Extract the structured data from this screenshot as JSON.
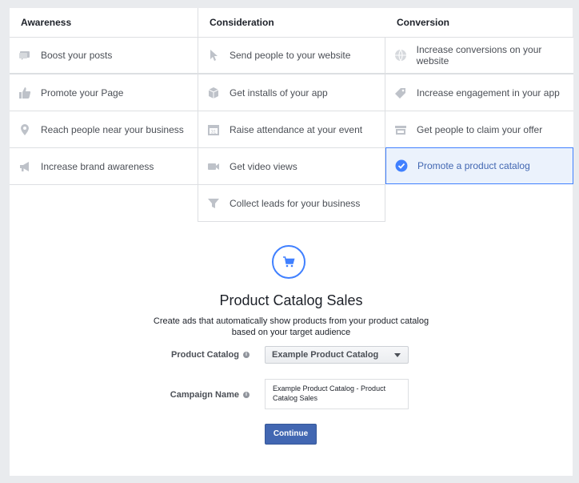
{
  "columns": [
    {
      "header": "Awareness",
      "items": [
        {
          "label": "Boost your posts",
          "icon": "boost-post-icon"
        },
        {
          "label": "Promote your Page",
          "icon": "thumbs-up-icon"
        },
        {
          "label": "Reach people near your business",
          "icon": "location-pin-icon"
        },
        {
          "label": "Increase brand awareness",
          "icon": "megaphone-icon"
        }
      ]
    },
    {
      "header": "Consideration",
      "items": [
        {
          "label": "Send people to your website",
          "icon": "cursor-icon"
        },
        {
          "label": "Get installs of your app",
          "icon": "app-box-icon"
        },
        {
          "label": "Raise attendance at your event",
          "icon": "calendar-icon"
        },
        {
          "label": "Get video views",
          "icon": "video-camera-icon"
        },
        {
          "label": "Collect leads for your business",
          "icon": "funnel-icon"
        }
      ]
    },
    {
      "header": "Conversion",
      "items": [
        {
          "label": "Increase conversions on your website",
          "icon": "globe-icon"
        },
        {
          "label": "Increase engagement in your app",
          "icon": "app-tag-icon"
        },
        {
          "label": "Get people to claim your offer",
          "icon": "offer-store-icon"
        },
        {
          "label": "Promote a product catalog",
          "icon": "check-circle-icon",
          "selected": true
        }
      ]
    }
  ],
  "detail": {
    "icon": "shopping-cart-icon",
    "title": "Product Catalog Sales",
    "description": "Create ads that automatically show products from your product catalog based on your target audience",
    "product_catalog_label": "Product Catalog",
    "product_catalog_value": "Example Product Catalog",
    "campaign_name_label": "Campaign Name",
    "campaign_name_value": "Example Product Catalog - Product Catalog Sales",
    "continue_label": "Continue"
  },
  "colors": {
    "accent": "#4267b2",
    "selected_bg": "#ebf2fc",
    "selected_border": "#4080ff",
    "icon_gray": "#bec2c9"
  }
}
